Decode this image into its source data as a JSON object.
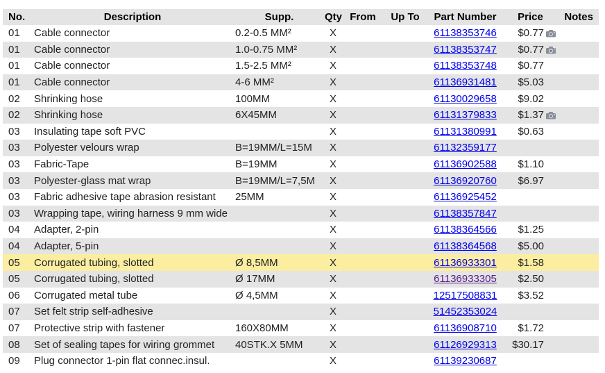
{
  "header": {
    "no": "No.",
    "description": "Description",
    "supp": "Supp.",
    "qty": "Qty",
    "from": "From",
    "up_to": "Up To",
    "part_number": "Part Number",
    "price": "Price",
    "notes": "Notes"
  },
  "rows": [
    {
      "no": "01",
      "description": "Cable connector",
      "supp": "0.2-0.5 MM²",
      "qty": "X",
      "from": "",
      "up_to": "",
      "part": "61138353746",
      "price": "$0.77",
      "camera": true
    },
    {
      "no": "01",
      "description": "Cable connector",
      "supp": "1.0-0.75 MM²",
      "qty": "X",
      "from": "",
      "up_to": "",
      "part": "61138353747",
      "price": "$0.77",
      "camera": true
    },
    {
      "no": "01",
      "description": "Cable connector",
      "supp": "1.5-2.5 MM²",
      "qty": "X",
      "from": "",
      "up_to": "",
      "part": "61138353748",
      "price": "$0.77",
      "camera": false
    },
    {
      "no": "01",
      "description": "Cable connector",
      "supp": "4-6 MM²",
      "qty": "X",
      "from": "",
      "up_to": "",
      "part": "61136931481",
      "price": "$5.03",
      "camera": false
    },
    {
      "no": "02",
      "description": "Shrinking hose",
      "supp": "100MM",
      "qty": "X",
      "from": "",
      "up_to": "",
      "part": "61130029658",
      "price": "$9.02",
      "camera": false
    },
    {
      "no": "02",
      "description": "Shrinking hose",
      "supp": "6X45MM",
      "qty": "X",
      "from": "",
      "up_to": "",
      "part": "61131379833",
      "price": "$1.37",
      "camera": true
    },
    {
      "no": "03",
      "description": "Insulating tape soft PVC",
      "supp": "",
      "qty": "X",
      "from": "",
      "up_to": "",
      "part": "61131380991",
      "price": "$0.63",
      "camera": false
    },
    {
      "no": "03",
      "description": "Polyester velours wrap",
      "supp": "B=19MM/L=15M",
      "qty": "X",
      "from": "",
      "up_to": "",
      "part": "61132359177",
      "price": "",
      "camera": false
    },
    {
      "no": "03",
      "description": "Fabric-Tape",
      "supp": "B=19MM",
      "qty": "X",
      "from": "",
      "up_to": "",
      "part": "61136902588",
      "price": "$1.10",
      "camera": false
    },
    {
      "no": "03",
      "description": "Polyester-glass mat wrap",
      "supp": "B=19MM/L=7,5M",
      "qty": "X",
      "from": "",
      "up_to": "",
      "part": "61136920760",
      "price": "$6.97",
      "camera": false
    },
    {
      "no": "03",
      "description": "Fabric adhesive tape abrasion resistant",
      "supp": "25MM",
      "qty": "X",
      "from": "",
      "up_to": "",
      "part": "61136925452",
      "price": "",
      "camera": false
    },
    {
      "no": "03",
      "description": "Wrapping tape, wiring harness 9 mm wide",
      "supp": "",
      "qty": "X",
      "from": "",
      "up_to": "",
      "part": "61138357847",
      "price": "",
      "camera": false
    },
    {
      "no": "04",
      "description": "Adapter, 2-pin",
      "supp": "",
      "qty": "X",
      "from": "",
      "up_to": "",
      "part": "61138364566",
      "price": "$1.25",
      "camera": false
    },
    {
      "no": "04",
      "description": "Adapter, 5-pin",
      "supp": "",
      "qty": "X",
      "from": "",
      "up_to": "",
      "part": "61138364568",
      "price": "$5.00",
      "camera": false
    },
    {
      "no": "05",
      "description": "Corrugated tubing, slotted",
      "supp": "Ø 8,5MM",
      "qty": "X",
      "from": "",
      "up_to": "",
      "part": "61136933301",
      "price": "$1.58",
      "camera": false,
      "highlight": true
    },
    {
      "no": "05",
      "description": "Corrugated tubing, slotted",
      "supp": "Ø 17MM",
      "qty": "X",
      "from": "",
      "up_to": "",
      "part": "61136933305",
      "price": "$2.50",
      "camera": false,
      "visited": true
    },
    {
      "no": "06",
      "description": "Corrugated metal tube",
      "supp": "Ø 4,5MM",
      "qty": "X",
      "from": "",
      "up_to": "",
      "part": "12517508831",
      "price": "$3.52",
      "camera": false
    },
    {
      "no": "07",
      "description": "Set felt strip self-adhesive",
      "supp": "",
      "qty": "X",
      "from": "",
      "up_to": "",
      "part": "51452353024",
      "price": "",
      "camera": false
    },
    {
      "no": "07",
      "description": "Protective strip with fastener",
      "supp": "160X80MM",
      "qty": "X",
      "from": "",
      "up_to": "",
      "part": "61136908710",
      "price": "$1.72",
      "camera": false
    },
    {
      "no": "08",
      "description": "Set of sealing tapes for wiring grommet",
      "supp": "40STK.X 5MM",
      "qty": "X",
      "from": "",
      "up_to": "",
      "part": "61126929313",
      "price": "$30.17",
      "camera": false
    },
    {
      "no": "09",
      "description": "Plug connector 1-pin flat connec.insul.",
      "supp": "",
      "qty": "X",
      "from": "",
      "up_to": "",
      "part": "61139230687",
      "price": "",
      "camera": false
    }
  ],
  "icons": {
    "camera": "camera-icon"
  },
  "colors": {
    "row_alt": "#e4e4e4",
    "highlight": "#fbeea0",
    "link": "#0000ee",
    "link_visited": "#551a8b"
  }
}
